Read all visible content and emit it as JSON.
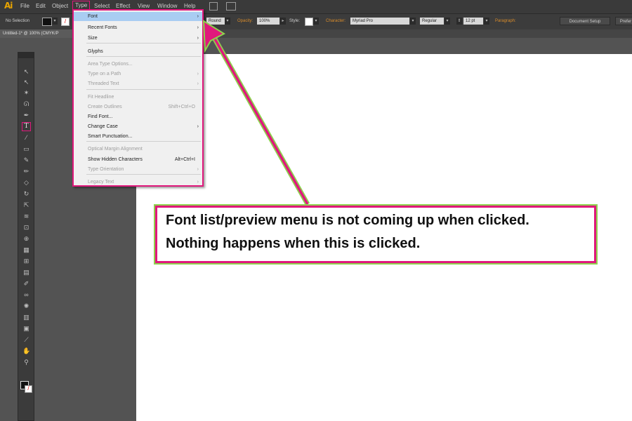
{
  "app": {
    "logo": "Ai"
  },
  "menubar": {
    "items": [
      "File",
      "Edit",
      "Object",
      "Type",
      "Select",
      "Effect",
      "View",
      "Window",
      "Help"
    ],
    "open_menu": "Type"
  },
  "control_bar": {
    "selection": "No Selection",
    "stroke_cap": "Round",
    "opacity_label": "Opacity:",
    "opacity_value": "100%",
    "style_label": "Style:",
    "character_label": "Character:",
    "font_value": "Myriad Pro",
    "style_value": "Regular",
    "size_value": "12 pt",
    "paragraph_label": "Paragraph:",
    "document_setup": "Document Setup",
    "preferences": "Prefer"
  },
  "document_tab": {
    "title": "Untitled-1* @ 100% (CMYK/P"
  },
  "type_menu": {
    "items": [
      {
        "label": "Font",
        "submenu": true,
        "enabled": true,
        "highlighted": true
      },
      {
        "label": "Recent Fonts",
        "submenu": true,
        "enabled": true
      },
      {
        "label": "Size",
        "submenu": true,
        "enabled": true
      },
      {
        "label": "Glyphs",
        "enabled": true
      },
      {
        "label": "Area Type Options...",
        "enabled": false
      },
      {
        "label": "Type on a Path",
        "submenu": true,
        "enabled": false
      },
      {
        "label": "Threaded Text",
        "submenu": true,
        "enabled": false
      },
      {
        "label": "Fit Headline",
        "enabled": false
      },
      {
        "label": "Create Outlines",
        "shortcut": "Shift+Ctrl+O",
        "enabled": false
      },
      {
        "label": "Find Font...",
        "enabled": true
      },
      {
        "label": "Change Case",
        "submenu": true,
        "enabled": true
      },
      {
        "label": "Smart Punctuation...",
        "enabled": true
      },
      {
        "label": "Optical Margin Alignment",
        "enabled": false
      },
      {
        "label": "Show Hidden Characters",
        "shortcut": "Alt+Ctrl+I",
        "enabled": true
      },
      {
        "label": "Type Orientation",
        "submenu": true,
        "enabled": false
      },
      {
        "label": "Legacy Text",
        "submenu": true,
        "enabled": false
      }
    ]
  },
  "callout": {
    "line1": "Font list/preview menu is not coming up when clicked.",
    "line2": "Nothing happens when this is clicked."
  },
  "colors": {
    "highlight_magenta": "#e0187c",
    "highlight_green": "#8ed24e",
    "menu_hover": "#a9cdf2",
    "logo_orange": "#e8a400"
  },
  "toolbox": {
    "tools": [
      "selection-tool",
      "direct-selection-tool",
      "magic-wand-tool",
      "lasso-tool",
      "pen-tool",
      "type-tool",
      "line-tool",
      "rectangle-tool",
      "paintbrush-tool",
      "pencil-tool",
      "eraser-tool",
      "rotate-tool",
      "scale-tool",
      "warp-tool",
      "free-transform-tool",
      "shape-builder-tool",
      "perspective-grid-tool",
      "mesh-tool",
      "gradient-tool",
      "eyedropper-tool",
      "blend-tool",
      "symbol-sprayer-tool",
      "column-graph-tool",
      "artboard-tool",
      "slice-tool",
      "hand-tool",
      "zoom-tool"
    ],
    "active": "type-tool",
    "type_tool_glyph": "T"
  }
}
